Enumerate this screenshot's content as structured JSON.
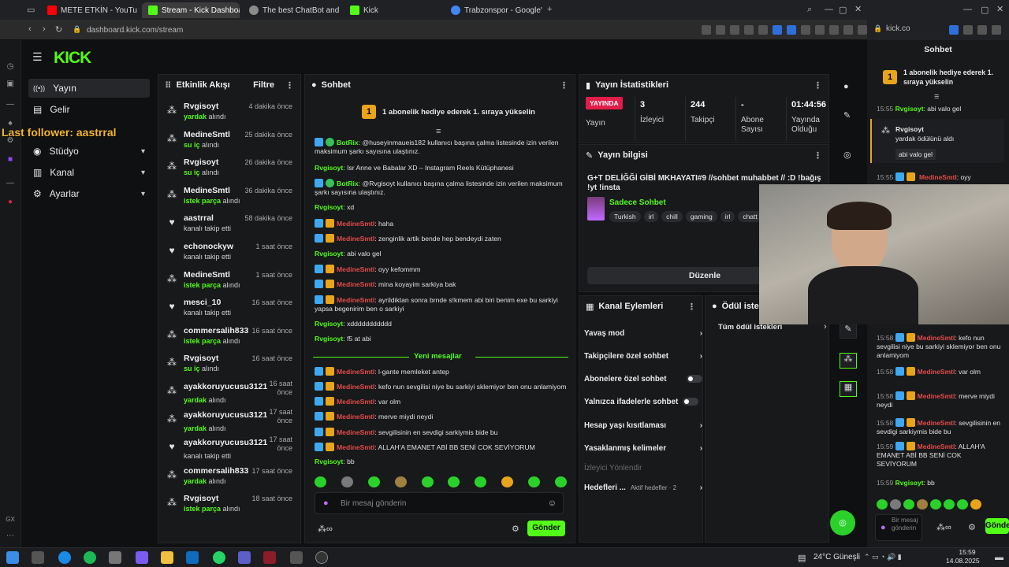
{
  "browser": {
    "tabs": [
      {
        "label": "METE ETKİN - YouTube"
      },
      {
        "label": "Stream - Kick Dashboard"
      },
      {
        "label": "The best ChatBot and W"
      },
      {
        "label": "Kick"
      },
      {
        "label": "Trabzonspor - Google'da"
      }
    ],
    "url": "dashboard.kick.com/stream",
    "right_url": "kick.co"
  },
  "sidebar": {
    "logo": "KICK",
    "items": [
      {
        "label": "Yayın"
      },
      {
        "label": "Gelir"
      },
      {
        "label": "Stüdyo"
      },
      {
        "label": "Kanal"
      },
      {
        "label": "Ayarlar"
      }
    ],
    "overlay": "Last follower: aastrral"
  },
  "activity": {
    "title": "Etkinlik Akışı",
    "filter": "Filtre",
    "rows": [
      {
        "user": "Rvgisoyt",
        "pre": "",
        "bold": "yardak",
        "post": " alındı",
        "time": "4 dakika önce",
        "icon": "gift"
      },
      {
        "user": "MedineSmtl",
        "pre": "",
        "bold": "su iç",
        "post": " alındı",
        "time": "25 dakika önce",
        "icon": "gift"
      },
      {
        "user": "Rvgisoyt",
        "pre": "",
        "bold": "su iç",
        "post": " alındı",
        "time": "26 dakika önce",
        "icon": "gift"
      },
      {
        "user": "MedineSmtl",
        "pre": "",
        "bold": "istek parça",
        "post": " alındı",
        "time": "36 dakika önce",
        "icon": "gift"
      },
      {
        "user": "aastrral",
        "pre": "kanalı takip etti",
        "bold": "",
        "post": "",
        "time": "58 dakika önce",
        "icon": "heart"
      },
      {
        "user": "echonockyw",
        "pre": "kanalı takip etti",
        "bold": "",
        "post": "",
        "time": "1 saat önce",
        "icon": "heart"
      },
      {
        "user": "MedineSmtl",
        "pre": "",
        "bold": "istek parça",
        "post": " alındı",
        "time": "1 saat önce",
        "icon": "gift"
      },
      {
        "user": "mesci_10",
        "pre": "kanalı takip etti",
        "bold": "",
        "post": "",
        "time": "16 saat önce",
        "icon": "heart"
      },
      {
        "user": "commersalih833",
        "pre": "",
        "bold": "istek parça",
        "post": " alındı",
        "time": "16 saat önce",
        "icon": "gift"
      },
      {
        "user": "Rvgisoyt",
        "pre": "",
        "bold": "su iç",
        "post": " alındı",
        "time": "16 saat önce",
        "icon": "gift"
      },
      {
        "user": "ayakkoruyucusu3121",
        "pre": "",
        "bold": "yardak",
        "post": " alındı",
        "time": "16 saat önce",
        "icon": "gift"
      },
      {
        "user": "ayakkoruyucusu3121",
        "pre": "",
        "bold": "yardak",
        "post": " alındı",
        "time": "17 saat önce",
        "icon": "gift"
      },
      {
        "user": "ayakkoruyucusu3121",
        "pre": "kanalı takip etti",
        "bold": "",
        "post": "",
        "time": "17 saat önce",
        "icon": "heart"
      },
      {
        "user": "commersalih833",
        "pre": "",
        "bold": "yardak",
        "post": " alındı",
        "time": "17 saat önce",
        "icon": "gift"
      },
      {
        "user": "Rvgisoyt",
        "pre": "",
        "bold": "istek parça",
        "post": " alındı",
        "time": "18 saat önce",
        "icon": "gift"
      }
    ]
  },
  "chat": {
    "title": "Sohbet",
    "pinned": "1 abonelik hediye ederek 1. sıraya yükselin",
    "pinned_rank": "1",
    "new_messages": "Yeni mesajlar",
    "placeholder": "Bir mesaj gönderin",
    "send": "Gönder",
    "messages": [
      {
        "user": "BotRix",
        "type": "bot",
        "text": ": @huseyinmaueis182 kullanıcı başına çalma listesinde izin verilen maksimum şarkı sayısına ulaştınız."
      },
      {
        "user": "Rvgisoyt",
        "type": "green",
        "text": ": Isr Anne ve Babalar XD – Instagram Reels Kütüphanesi"
      },
      {
        "user": "BotRix",
        "type": "bot",
        "text": ": @Rvgisoyt kullanıcı başına çalma listesinde izin verilen maksimum şarkı sayısına ulaştınız."
      },
      {
        "user": "Rvgisoyt",
        "type": "green",
        "text": ": xd"
      },
      {
        "user": "MedineSmtl",
        "type": "red",
        "text": ": haha"
      },
      {
        "user": "MedineSmtl",
        "type": "red",
        "text": ": zenginlik artik bende hep bendeydi zaten"
      },
      {
        "user": "Rvgisoyt",
        "type": "green",
        "text": ": abi valo gel"
      },
      {
        "user": "MedineSmtl",
        "type": "red",
        "text": ": oyy kefommm"
      },
      {
        "user": "MedineSmtl",
        "type": "red",
        "text": ": mina koyayim sarkiya bak"
      },
      {
        "user": "MedineSmtl",
        "type": "red",
        "text": ": ayrildiktan sonra brnde s!kmem abi biri benim exe bu sarkiyi yapsa begenirim ben o sarkiyi"
      },
      {
        "user": "Rvgisoyt",
        "type": "green",
        "text": ": xddddddddddd"
      },
      {
        "user": "Rvgisoyt",
        "type": "green",
        "text": ": f5 at abi"
      },
      {
        "user": "MedineSmtl",
        "type": "red",
        "text": ": l-gante memleket antep"
      },
      {
        "user": "MedineSmtl",
        "type": "red",
        "text": ": kefo nun sevgilisi niye bu sarkiyi sklemiyor ben onu anlamiyom"
      },
      {
        "user": "MedineSmtl",
        "type": "red",
        "text": ": var olm"
      },
      {
        "user": "MedineSmtl",
        "type": "red",
        "text": ": merve miydi neydi"
      },
      {
        "user": "MedineSmtl",
        "type": "red",
        "text": ": sevgilisinin en sevdigi sarkiymis bide bu"
      },
      {
        "user": "MedineSmtl",
        "type": "red",
        "text": ": ALLAH'A EMANET ABİ BB SENİ COK SEVİYORUM"
      },
      {
        "user": "Rvgisoyt",
        "type": "green",
        "text": ": bb"
      }
    ]
  },
  "stats": {
    "title": "Yayın İstatistikleri",
    "live": "YAYINDA",
    "live_label": "Yayın",
    "viewers": "3",
    "viewers_label": "İzleyici",
    "followers": "244",
    "followers_label": "Takipçi",
    "subs": "-",
    "subs_label": "Abone Sayısı",
    "uptime": "01:44:56",
    "uptime_label": "Yayında Olduğu"
  },
  "info": {
    "title": "Yayın bilgisi",
    "stream_title": "G+T DELİĞĞİ GİBİ MKHAYATI#9 //sohbet muhabbet // :D !bağış !yt !insta",
    "category": "Sadece Sohbet",
    "tags": [
      "Turkish",
      "irl",
      "chill",
      "gaming",
      "irl",
      "chatt"
    ],
    "edit": "Düzenle"
  },
  "actions": {
    "title": "Kanal Eylemleri",
    "slow": "Yavaş mod",
    "followers": "Takipçilere özel sohbet",
    "subs": "Abonelere özel sohbet",
    "emotes": "Yalnızca ifadelerle sohbet",
    "age": "Hesap yaşı kısıtlaması",
    "banned": "Yasaklanmış kelimeler",
    "viewer_dir": "İzleyici Yönlendir",
    "goals": "Hedefleri ...",
    "goals_active": "Aktif hedefler · 2"
  },
  "rewards": {
    "title": "Ödül istek",
    "all": "Tüm ödül istekleri"
  },
  "rightchat": {
    "title": "Sohbet",
    "pinned": "1 abonelik hediye ederek 1. sıraya yükselin",
    "rank": "1",
    "msg1_time": "15:55",
    "msg1_user": "Rvgisoyt",
    "msg1_text": ": abi valo gel",
    "reward_user": "Rvgisoyt",
    "reward_text": "yardak ödülünü aldı",
    "reward_msg": "abi valo gel",
    "msg2_time": "15:55",
    "msg2_user": "MedineSmtl",
    "msg2_text": ": oyy",
    "msgs": [
      {
        "time": "15:58",
        "user": "MedineSmtl",
        "text": ": kefo nun sevgilisi niye bu sarkiyi sklemiyor ben onu anlamiyom"
      },
      {
        "time": "15:58",
        "user": "MedineSmtl",
        "text": ": var olm"
      },
      {
        "time": "15:58",
        "user": "MedineSmtl",
        "text": ": merve miydi neydi"
      },
      {
        "time": "15:58",
        "user": "MedineSmtl",
        "text": ": sevgilisinin en sevdigi sarkiymis bide bu"
      },
      {
        "time": "15:59",
        "user": "MedineSmtl",
        "text": ": ALLAH'A EMANET ABİ BB SENİ COK SEVİYORUM"
      },
      {
        "time": "15:59",
        "user": "Rvgisoyt",
        "text": ": bb"
      }
    ],
    "placeholder": "Bir mesaj gönderin",
    "send": "Gönder"
  },
  "taskbar": {
    "weather": "24°C Güneşli",
    "time": "15:59",
    "date": "14.08.2025"
  },
  "colors": {
    "accent": "#53fc18",
    "live": "#e11d48",
    "panel": "#18191b"
  }
}
